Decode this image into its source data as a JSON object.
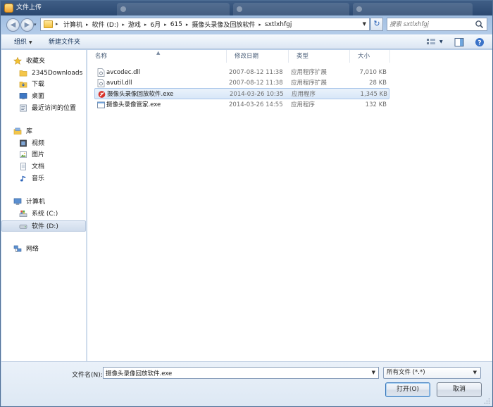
{
  "window": {
    "title": "文件上传"
  },
  "address_bar": {
    "crumbs": [
      "计算机",
      "软件 (D:)",
      "游戏",
      "6月",
      "615",
      "摄像头录像及回放软件",
      "sxtlxhfgj"
    ]
  },
  "search": {
    "placeholder": "搜索 sxtlxhfgj"
  },
  "toolbar": {
    "organize_label": "组织",
    "new_folder_label": "新建文件夹"
  },
  "nav": {
    "favorites": {
      "label": "收藏夹",
      "items": [
        "2345Downloads",
        "下载",
        "桌面",
        "最近访问的位置"
      ]
    },
    "libraries": {
      "label": "库",
      "items": [
        "视频",
        "图片",
        "文档",
        "音乐"
      ]
    },
    "computer": {
      "label": "计算机",
      "items": [
        "系统 (C:)",
        "软件 (D:)"
      ]
    },
    "network": {
      "label": "网络"
    }
  },
  "file_list": {
    "columns": {
      "name": "名称",
      "modified": "修改日期",
      "type": "类型",
      "size": "大小"
    },
    "rows": [
      {
        "name": "avcodec.dll",
        "modified": "2007-08-12 11:38",
        "type": "应用程序扩展",
        "size": "7,010 KB",
        "icon": "dll-file-icon"
      },
      {
        "name": "avutil.dll",
        "modified": "2007-08-12 11:38",
        "type": "应用程序扩展",
        "size": "28 KB",
        "icon": "dll-file-icon"
      },
      {
        "name": "摄像头录像回放软件.exe",
        "modified": "2014-03-26 10:35",
        "type": "应用程序",
        "size": "1,345 KB",
        "icon": "player-app-icon"
      },
      {
        "name": "摄像头录像管家.exe",
        "modified": "2014-03-26 14:55",
        "type": "应用程序",
        "size": "132 KB",
        "icon": "exe-window-icon"
      }
    ]
  },
  "footer": {
    "filename_label": "文件名(N):",
    "filename_value": "摄像头录像回放软件.exe",
    "filetype_value": "所有文件 (*.*)",
    "open_label": "打开(O)",
    "cancel_label": "取消"
  }
}
